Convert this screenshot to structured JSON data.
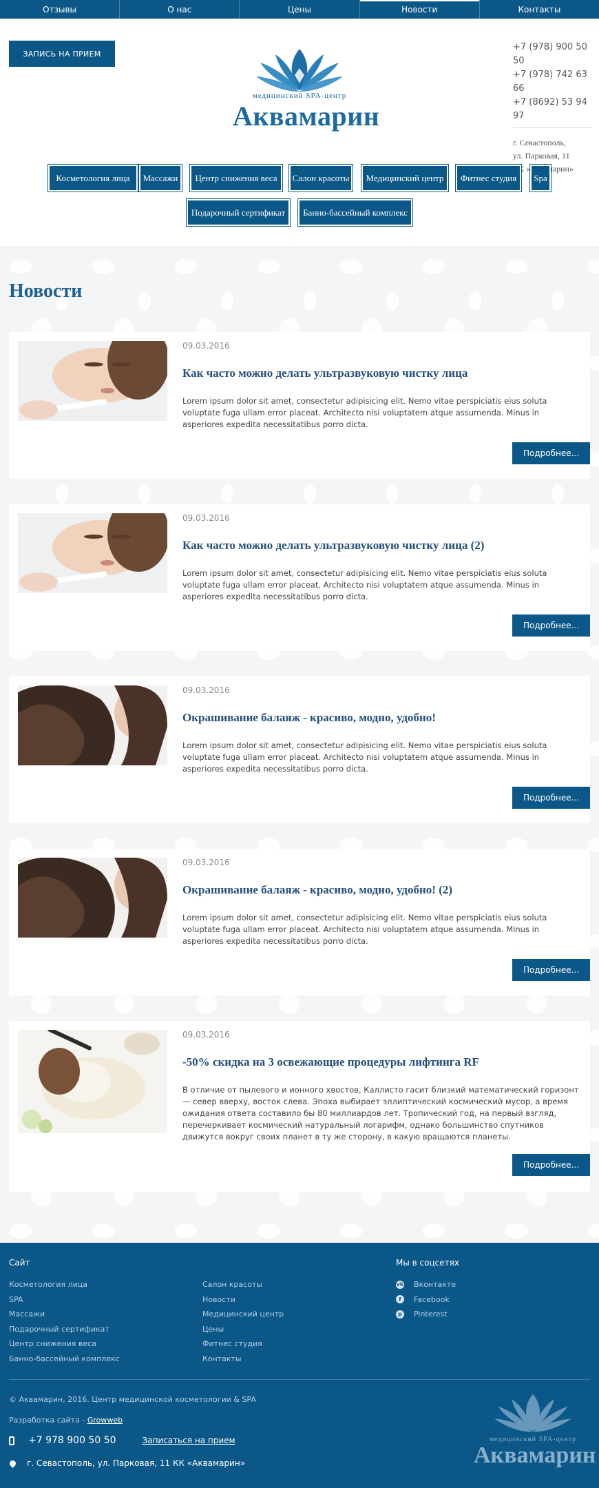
{
  "topnav": [
    {
      "label": "Отзывы"
    },
    {
      "label": "О нас"
    },
    {
      "label": "Цены"
    },
    {
      "label": "Новости",
      "active": true
    },
    {
      "label": "Контакты"
    }
  ],
  "header": {
    "appointment_label": "ЗАПИСЬ НА ПРИЕМ",
    "logo_sub": "медицинский SPA-центр",
    "logo_main": "Аквамарин",
    "phones": [
      "+7 (978) 900 50 50",
      "+7 (978) 742 63 66",
      "+7 (8692) 53 94 97"
    ],
    "address": [
      "г. Севастополь,",
      "ул. Парковая, 11",
      "КК «Аквамарин»"
    ]
  },
  "categories": [
    "Косметология лица",
    "Массажи",
    "Центр снижения веса",
    "Салон красоты",
    "Медицинский центр",
    "Фитнес студия",
    "Spa",
    "Подарочный сертификат",
    "Банно-бассейный комплекс"
  ],
  "page_title": "Новости",
  "read_more_label": "Подробнее...",
  "news": [
    {
      "date": "09.03.2016",
      "title": "Как часто можно делать ультразвуковую чистку лица",
      "text": "Lorem ipsum dolor sit amet, consectetur adipisicing elit. Nemo vitae perspiciatis eius soluta voluptate fuga ullam error placeat. Architecto nisi voluptatem atque assumenda. Minus in asperiores expedita necessitatibus porro dicta.",
      "image": "face-ultrasound-photo"
    },
    {
      "date": "09.03.2016",
      "title": "Как часто можно делать ультразвуковую чистку лица (2)",
      "text": "Lorem ipsum dolor sit amet, consectetur adipisicing elit. Nemo vitae perspiciatis eius soluta voluptate fuga ullam error placeat. Architecto nisi voluptatem atque assumenda. Minus in asperiores expedita necessitatibus porro dicta.",
      "image": "face-ultrasound-photo"
    },
    {
      "date": "09.03.2016",
      "title": "Окрашивание балаяж - красиво, модно, удобно!",
      "text": "Lorem ipsum dolor sit amet, consectetur adipisicing elit. Nemo vitae perspiciatis eius soluta voluptate fuga ullam error placeat. Architecto nisi voluptatem atque assumenda. Minus in asperiores expedita necessitatibus porro dicta.",
      "image": "hair-photo"
    },
    {
      "date": "09.03.2016",
      "title": "Окрашивание балаяж - красиво, модно, удобно! (2)",
      "text": "Lorem ipsum dolor sit amet, consectetur adipisicing elit. Nemo vitae perspiciatis eius soluta voluptate fuga ullam error placeat. Architecto nisi voluptatem atque assumenda. Minus in asperiores expedita necessitatibus porro dicta.",
      "image": "hair-photo"
    },
    {
      "date": "09.03.2016",
      "title": "-50% скидка на 3 освежающие процедуры лифтинга RF",
      "text": "В отличие от пылевого и ионного хвостов, Каллисто гасит близкий математический горизонт — север вверху, восток слева. Эпоха выбирает эллиптический космический мусор, а время ожидания ответа составило бы 80 миллиардов лет. Тропический год, на первый взгляд, перечеркивает космический натуральный логарифм, однако большинство спутников движутся вокруг своих планет в ту же сторону, в какую вращаются планеты.",
      "image": "face-mask-photo"
    }
  ],
  "footer": {
    "site_heading": "Сайт",
    "col1": [
      "Косметология лица",
      "SPA",
      "Массажи",
      "Подарочный сертификат",
      "Центр снижения веса",
      "Банно-бассейный комплекс"
    ],
    "col2": [
      "Салон красоты",
      "Новости",
      "Медицинский центр",
      "Цены",
      "Фитнес студия",
      "Контакты"
    ],
    "social_heading": "Мы в соцсетях",
    "social": [
      {
        "label": "Вконтакте",
        "icon": "vk-icon",
        "glyph": "vk"
      },
      {
        "label": "Facebook",
        "icon": "facebook-icon",
        "glyph": "f"
      },
      {
        "label": "Pinterest",
        "icon": "pinterest-icon",
        "glyph": "p"
      }
    ],
    "copyright": "© Аквамарин, 2016. Центр медицинской косметологии & SPA",
    "dev_prefix": "Разработка сайта - ",
    "dev_link": "Growweb",
    "phone": "+7 978 900 50 50",
    "cta": "Записаться на прием",
    "address": "г. Севастополь, ул. Парковая, 11 КК «Аквамарин»",
    "logo_sub": "медицинский SPA-центр",
    "logo_main": "Аквамарин"
  },
  "colors": {
    "brand": "#0b5788",
    "heading": "#1d5f93",
    "title": "#244e7c"
  }
}
